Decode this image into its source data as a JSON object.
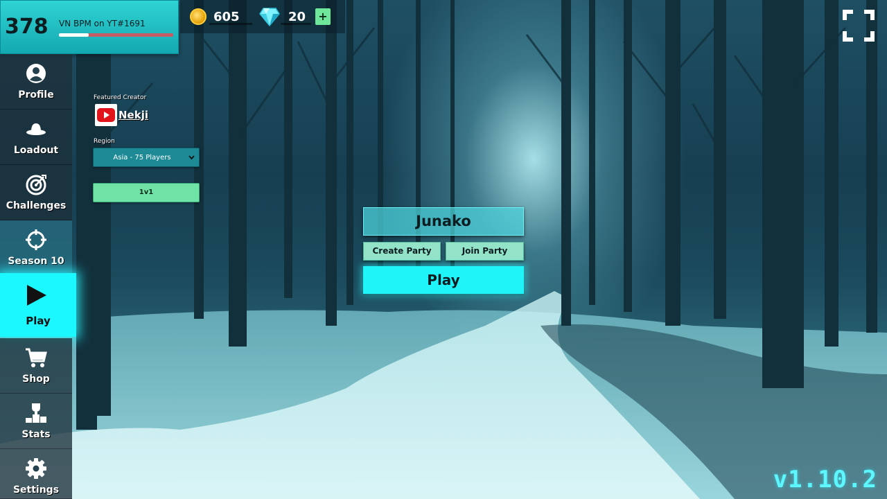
{
  "player": {
    "level": "378",
    "name": "VN BPM on YT#1691",
    "xp_fraction": 0.26
  },
  "currency": {
    "coins": "605",
    "gems": "20",
    "add_label": "+"
  },
  "nav": {
    "profile": "Profile",
    "loadout": "Loadout",
    "challenges": "Challenges",
    "season": "Season 10",
    "play": "Play",
    "shop": "Shop",
    "stats": "Stats",
    "settings": "Settings",
    "active": "play"
  },
  "featured": {
    "label": "Featured Creator",
    "creator": "Nekji"
  },
  "region": {
    "label": "Region",
    "selected": "Asia - 75 Players"
  },
  "mode": {
    "selected": "1v1"
  },
  "lobby": {
    "player_name": "Junako",
    "create_party": "Create Party",
    "join_party": "Join Party",
    "play": "Play"
  },
  "version": "v1.10.2",
  "colors": {
    "accent": "#1ff5f8",
    "mode_button": "#6fe2a6",
    "version_text": "#5ff7ff"
  },
  "icons": [
    "coin-icon",
    "diamond-icon",
    "fullscreen-icon",
    "user-icon",
    "hat-icon",
    "target-icon",
    "crosshair-icon",
    "play-icon",
    "cart-icon",
    "trophy-icon",
    "gear-icon",
    "youtube-icon"
  ]
}
